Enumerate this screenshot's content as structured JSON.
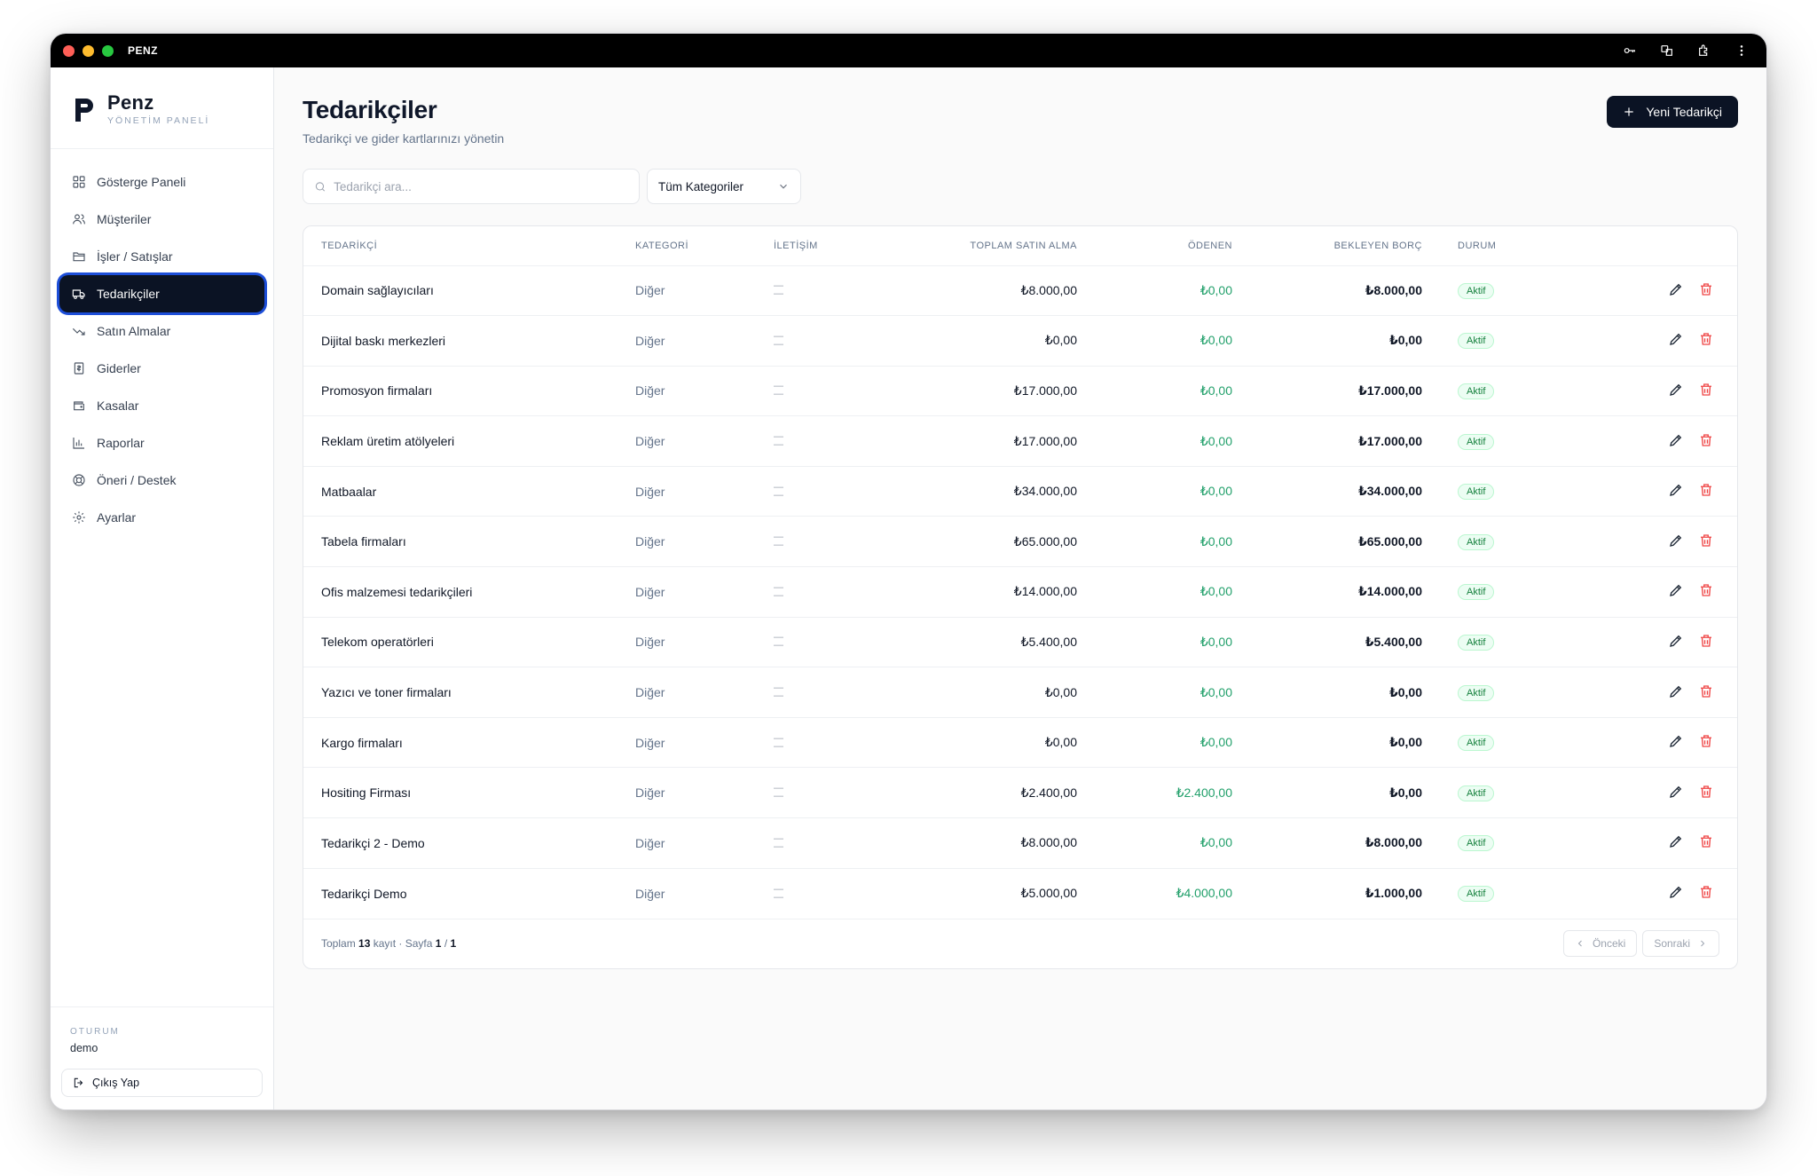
{
  "window": {
    "title": "PENZ"
  },
  "brand": {
    "name": "Penz",
    "subtitle": "YÖNETİM PANELİ"
  },
  "nav": [
    {
      "label": "Gösterge Paneli",
      "icon": "dashboard-icon"
    },
    {
      "label": "Müşteriler",
      "icon": "users-icon"
    },
    {
      "label": "İşler / Satışlar",
      "icon": "folder-icon"
    },
    {
      "label": "Tedarikçiler",
      "icon": "truck-icon",
      "active": true
    },
    {
      "label": "Satın Almalar",
      "icon": "trend-down-icon"
    },
    {
      "label": "Giderler",
      "icon": "receipt-icon"
    },
    {
      "label": "Kasalar",
      "icon": "wallet-icon"
    },
    {
      "label": "Raporlar",
      "icon": "bar-chart-icon"
    },
    {
      "label": "Öneri / Destek",
      "icon": "lifebuoy-icon"
    },
    {
      "label": "Ayarlar",
      "icon": "gear-icon"
    }
  ],
  "session": {
    "label": "OTURUM",
    "user": "demo",
    "logout_label": "Çıkış Yap"
  },
  "page": {
    "title": "Tedarikçiler",
    "subtitle": "Tedarikçi ve gider kartlarınızı yönetin",
    "new_button": "Yeni Tedarikçi"
  },
  "filters": {
    "search_placeholder": "Tedarikçi ara...",
    "category_selected": "Tüm Kategoriler"
  },
  "table": {
    "columns": [
      "TEDARİKÇİ",
      "KATEGORİ",
      "İLETİŞİM",
      "TOPLAM SATIN ALMA",
      "ÖDENEN",
      "BEKLEYEN BORÇ",
      "DURUM"
    ],
    "rows": [
      {
        "name": "Domain sağlayıcıları",
        "category": "Diğer",
        "contact": "—\n—",
        "total": "₺8.000,00",
        "paid": "₺0,00",
        "debt": "₺8.000,00",
        "status": "Aktif"
      },
      {
        "name": "Dijital baskı merkezleri",
        "category": "Diğer",
        "contact": "—\n—",
        "total": "₺0,00",
        "paid": "₺0,00",
        "debt": "₺0,00",
        "status": "Aktif"
      },
      {
        "name": "Promosyon firmaları",
        "category": "Diğer",
        "contact": "—\n—",
        "total": "₺17.000,00",
        "paid": "₺0,00",
        "debt": "₺17.000,00",
        "status": "Aktif"
      },
      {
        "name": "Reklam üretim atölyeleri",
        "category": "Diğer",
        "contact": "—\n—",
        "total": "₺17.000,00",
        "paid": "₺0,00",
        "debt": "₺17.000,00",
        "status": "Aktif"
      },
      {
        "name": "Matbaalar",
        "category": "Diğer",
        "contact": "—\n—",
        "total": "₺34.000,00",
        "paid": "₺0,00",
        "debt": "₺34.000,00",
        "status": "Aktif"
      },
      {
        "name": "Tabela firmaları",
        "category": "Diğer",
        "contact": "—\n—",
        "total": "₺65.000,00",
        "paid": "₺0,00",
        "debt": "₺65.000,00",
        "status": "Aktif"
      },
      {
        "name": "Ofis malzemesi tedarikçileri",
        "category": "Diğer",
        "contact": "—\n—",
        "total": "₺14.000,00",
        "paid": "₺0,00",
        "debt": "₺14.000,00",
        "status": "Aktif"
      },
      {
        "name": "Telekom operatörleri",
        "category": "Diğer",
        "contact": "—\n—",
        "total": "₺5.400,00",
        "paid": "₺0,00",
        "debt": "₺5.400,00",
        "status": "Aktif"
      },
      {
        "name": "Yazıcı ve toner firmaları",
        "category": "Diğer",
        "contact": "—\n—",
        "total": "₺0,00",
        "paid": "₺0,00",
        "debt": "₺0,00",
        "status": "Aktif"
      },
      {
        "name": "Kargo firmaları",
        "category": "Diğer",
        "contact": "—\n—",
        "total": "₺0,00",
        "paid": "₺0,00",
        "debt": "₺0,00",
        "status": "Aktif"
      },
      {
        "name": "Hositing Firması",
        "category": "Diğer",
        "contact": "—\n—",
        "total": "₺2.400,00",
        "paid": "₺2.400,00",
        "debt": "₺0,00",
        "status": "Aktif"
      },
      {
        "name": "Tedarikçi 2 - Demo",
        "category": "Diğer",
        "contact": "—\n—",
        "total": "₺8.000,00",
        "paid": "₺0,00",
        "debt": "₺8.000,00",
        "status": "Aktif"
      },
      {
        "name": "Tedarikçi Demo",
        "category": "Diğer",
        "contact": "—\n—",
        "total": "₺5.000,00",
        "paid": "₺4.000,00",
        "debt": "₺1.000,00",
        "status": "Aktif"
      }
    ]
  },
  "footer": {
    "total_prefix": "Toplam",
    "total_count": "13",
    "total_suffix": "kayıt · Sayfa",
    "page_current": "1",
    "page_sep": "/",
    "page_total": "1",
    "prev_label": "Önceki",
    "next_label": "Sonraki"
  },
  "colors": {
    "accent": "#0b1324",
    "paid_green": "#22a06b",
    "badge_green": "#15803d",
    "delete_red": "#ef4444"
  }
}
